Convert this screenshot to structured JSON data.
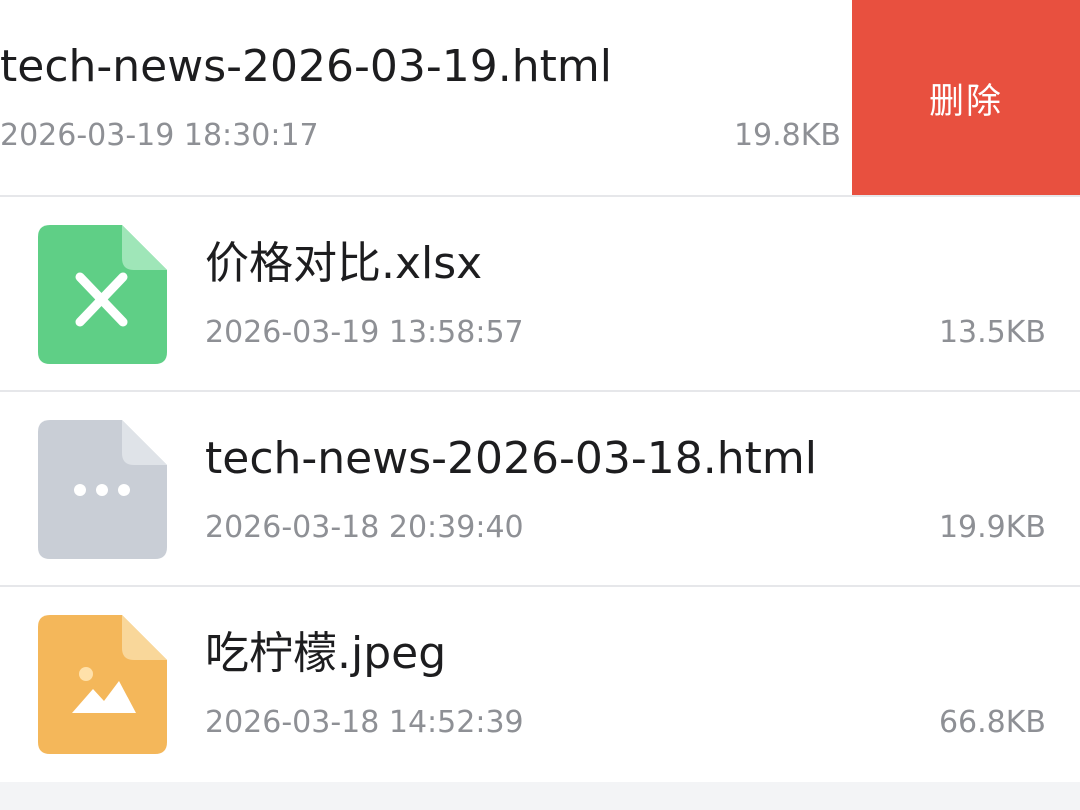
{
  "delete_label": "删除",
  "files": [
    {
      "name": "tech-news-2026-03-19.html",
      "date": "2026-03-19 18:30:17",
      "size": "19.8KB",
      "type": "html",
      "icon": "document-more-icon"
    },
    {
      "name": "价格对比.xlsx",
      "date": "2026-03-19 13:58:57",
      "size": "13.5KB",
      "type": "xlsx",
      "icon": "spreadsheet-file-icon"
    },
    {
      "name": "tech-news-2026-03-18.html",
      "date": "2026-03-18 20:39:40",
      "size": "19.9KB",
      "type": "html",
      "icon": "document-more-icon"
    },
    {
      "name": "吃柠檬.jpeg",
      "date": "2026-03-18 14:52:39",
      "size": "66.8KB",
      "type": "jpeg",
      "icon": "image-file-icon"
    }
  ],
  "colors": {
    "delete": "#e8503f",
    "xlsx": "#5fcf86",
    "html": "#c9ced6",
    "jpeg": "#f4b75a"
  }
}
